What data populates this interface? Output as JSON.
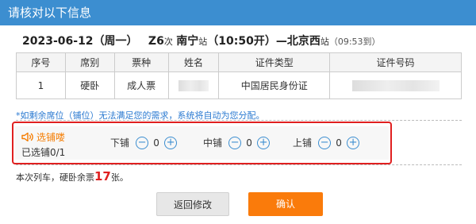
{
  "header": {
    "title": "请核对以下信息"
  },
  "trip": {
    "date": "2023-06-12",
    "weekday": "（周一）",
    "train_no": "Z6",
    "train_suffix": "次",
    "from_station": "南宁",
    "station_suffix": "站",
    "depart": "（10:50开）",
    "arrow": "—",
    "to_station": "北京西",
    "to_suffix": "站",
    "arrive": "（09:53到）"
  },
  "table": {
    "columns": [
      "序号",
      "席别",
      "票种",
      "姓名",
      "证件类型",
      "证件号码"
    ],
    "rows": [
      {
        "index": "1",
        "seat": "硬卧",
        "ticket_type": "成人票",
        "name": "",
        "id_type": "中国居民身份证",
        "id_number": ""
      }
    ]
  },
  "notice": "*如剩余席位（铺位）无法满足您的需求，系统将自动为您分配。",
  "berth_select": {
    "title": "选铺喽",
    "selected_text": "已选铺0/1",
    "lower": {
      "label": "下铺",
      "count": "0"
    },
    "middle": {
      "label": "中铺",
      "count": "0"
    },
    "upper": {
      "label": "上铺",
      "count": "0"
    }
  },
  "remaining": {
    "prefix": "本次列车，硬卧余票",
    "count": "17",
    "suffix": "张。"
  },
  "buttons": {
    "back": "返回修改",
    "confirm": "确认"
  },
  "colors": {
    "header": "#3c8ed0",
    "accent_orange": "#fa7b0b",
    "highlight_red": "#e02020",
    "link_blue": "#2b7ad1"
  }
}
